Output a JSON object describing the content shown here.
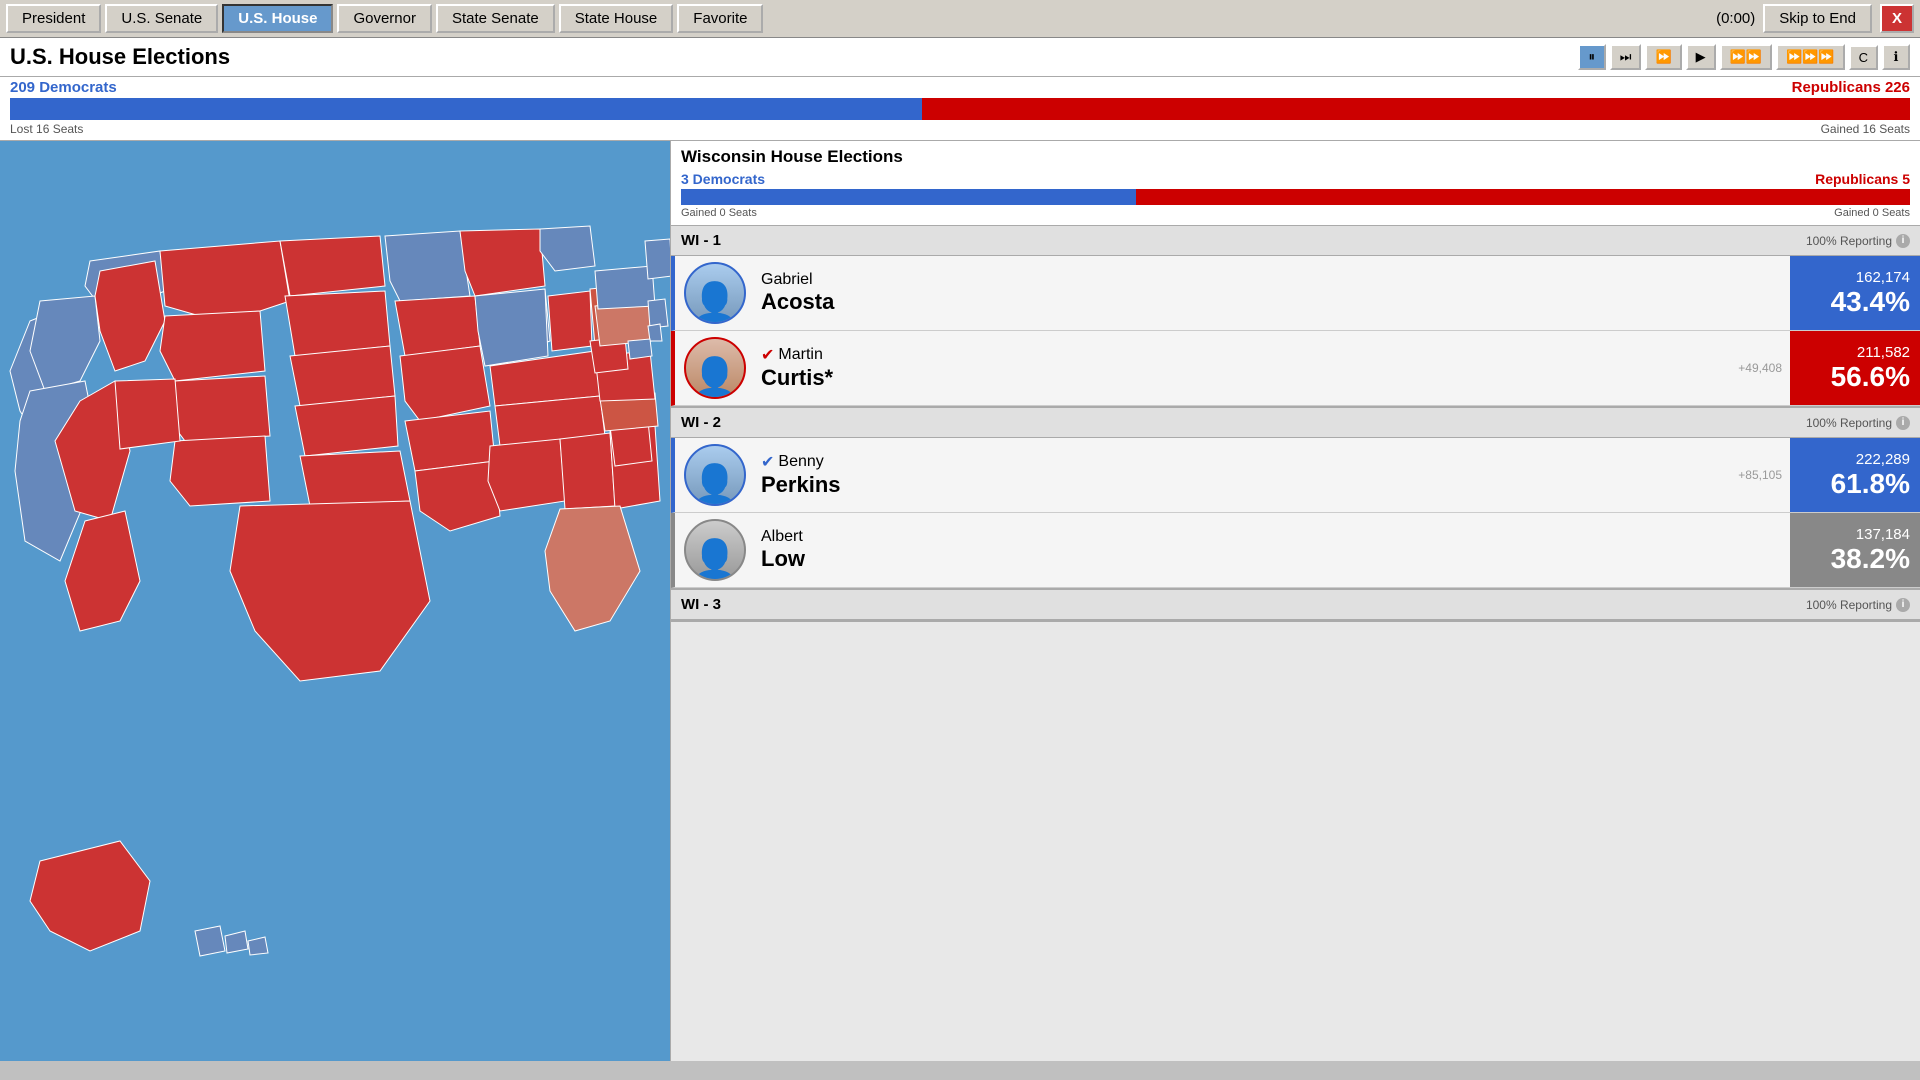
{
  "nav": {
    "items": [
      {
        "label": "President",
        "active": false
      },
      {
        "label": "U.S. Senate",
        "active": false
      },
      {
        "label": "U.S. House",
        "active": true
      },
      {
        "label": "Governor",
        "active": false
      },
      {
        "label": "State Senate",
        "active": false
      },
      {
        "label": "State House",
        "active": false
      },
      {
        "label": "Favorite",
        "active": false
      }
    ],
    "timer": "(0:00)",
    "skip_label": "Skip to End",
    "close_label": "X"
  },
  "header": {
    "title": "U.S. House Elections",
    "controls": [
      "⏸",
      "⏭",
      "⏩",
      "▶",
      "⏩⏩",
      "⏩⏩⏩",
      "C",
      "ℹ"
    ]
  },
  "seat_bar": {
    "dem_label": "209 Democrats",
    "rep_label": "Republicans 226",
    "dem_pct": 48,
    "rep_pct": 52,
    "lost_label": "Lost 16 Seats",
    "gained_label": "Gained 16 Seats"
  },
  "wi": {
    "title": "Wisconsin House Elections",
    "dem_label": "3 Democrats",
    "rep_label": "Republicans 5",
    "dem_pct": 37,
    "rep_pct": 63,
    "gained_dem": "Gained 0 Seats",
    "gained_rep": "Gained 0 Seats"
  },
  "districts": [
    {
      "id": "WI - 1",
      "reporting": "100% Reporting",
      "candidates": [
        {
          "first": "Gabriel",
          "last": "Acosta",
          "party": "dem",
          "won": false,
          "votes": "162,174",
          "pct": "43.4%",
          "diff": ""
        },
        {
          "first": "Martin",
          "last": "Curtis*",
          "party": "rep",
          "won": true,
          "votes": "211,582",
          "pct": "56.6%",
          "diff": "+49,408"
        }
      ]
    },
    {
      "id": "WI - 2",
      "reporting": "100% Reporting",
      "candidates": [
        {
          "first": "Benny",
          "last": "Perkins",
          "party": "dem",
          "won": true,
          "votes": "222,289",
          "pct": "61.8%",
          "diff": "+85,105"
        },
        {
          "first": "Albert",
          "last": "Low",
          "party": "ind",
          "won": false,
          "votes": "137,184",
          "pct": "38.2%",
          "diff": ""
        }
      ]
    },
    {
      "id": "WI - 3",
      "reporting": "100% Reporting",
      "candidates": []
    }
  ]
}
